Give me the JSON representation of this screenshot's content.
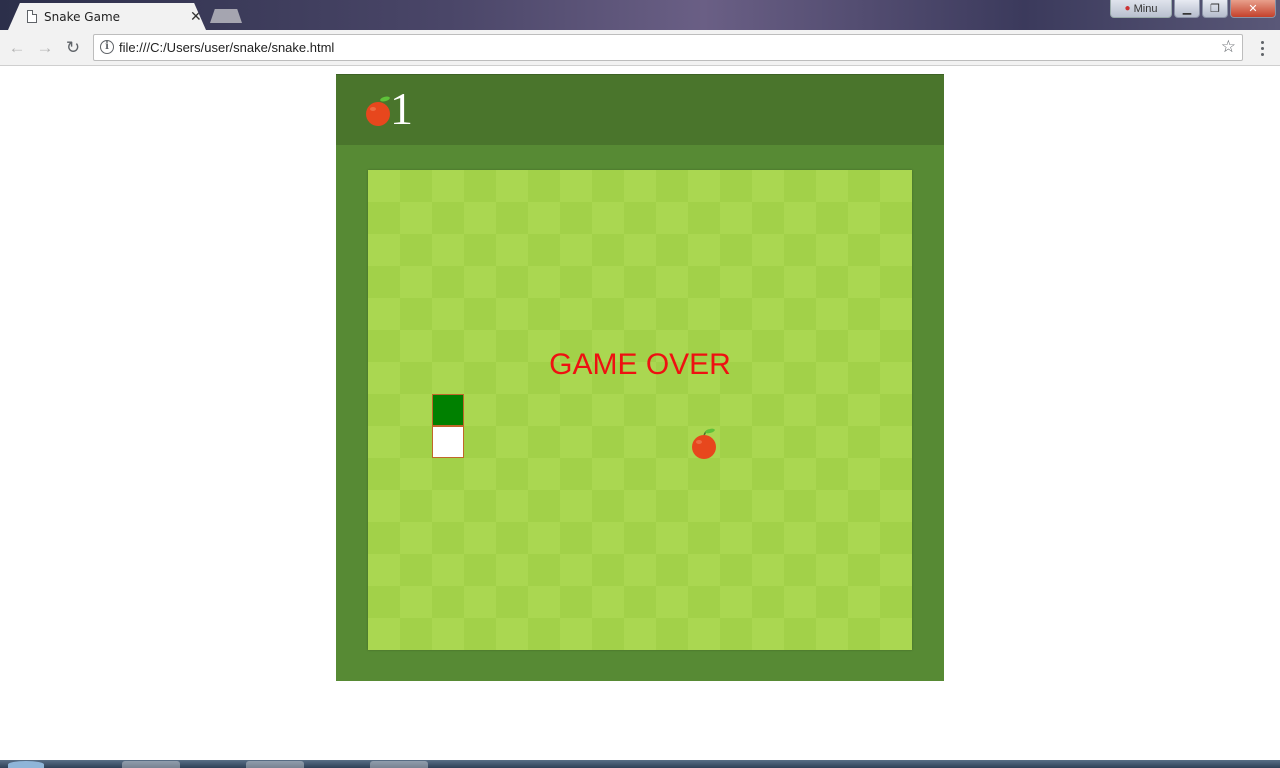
{
  "browser": {
    "tab_title": "Snake Game",
    "tab_close": "✕",
    "url": "file:///C:/Users/user/snake/snake.html",
    "profile_label": "Minu"
  },
  "game": {
    "score": "1",
    "status_text": "GAME OVER",
    "colors": {
      "header": "#4a752c",
      "frame": "#578a34",
      "board_light": "#aad751",
      "board_dark": "#a2d149",
      "snake_head": "#008000",
      "snake_body": "#ffffff",
      "game_over_text": "#ee1111"
    }
  }
}
